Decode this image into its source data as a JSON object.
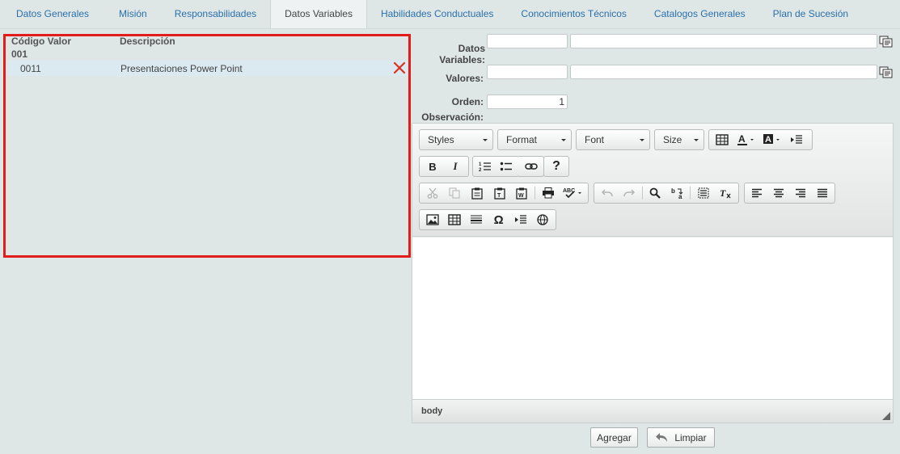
{
  "tabs": [
    {
      "label": "Datos Generales"
    },
    {
      "label": "Misión"
    },
    {
      "label": "Responsabilidades"
    },
    {
      "label": "Datos Variables",
      "active": true
    },
    {
      "label": "Habilidades Conductuales"
    },
    {
      "label": "Conocimientos Técnicos"
    },
    {
      "label": "Catalogos Generales"
    },
    {
      "label": "Plan de Sucesión"
    }
  ],
  "grid": {
    "col_code": "Código Valor",
    "col_desc": "Descripción",
    "group_code": "001",
    "rows": [
      {
        "code": "0011",
        "description": "Presentaciones Power Point"
      }
    ]
  },
  "form": {
    "datos_variables_label": "Datos Variables:",
    "valores_label": "Valores:",
    "orden_label": "Orden:",
    "orden_value": "1",
    "observacion_label": "Observación:"
  },
  "editor": {
    "styles_label": "Styles",
    "format_label": "Format",
    "font_label": "Font",
    "size_label": "Size",
    "status_path": "body"
  },
  "buttons": {
    "agregar": "Agregar",
    "limpiar": "Limpiar"
  },
  "colors": {
    "tab_link": "#2a6fab",
    "highlight_border": "#e21b1b",
    "delete_icon": "#d9331f",
    "selected_row": "#dbe9f0"
  }
}
